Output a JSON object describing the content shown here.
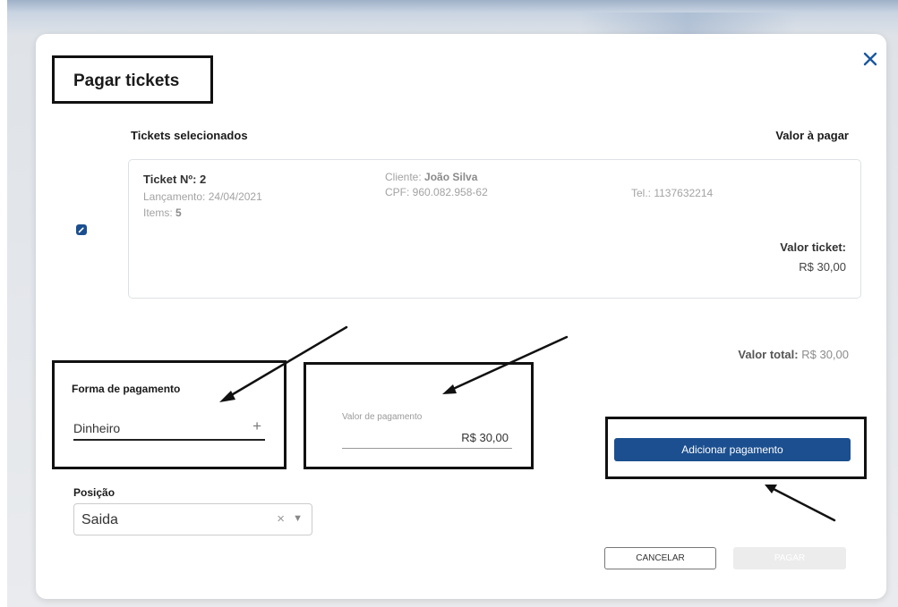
{
  "modal": {
    "title": "Pagar tickets",
    "close_icon": "close-icon"
  },
  "tickets": {
    "header_selected": "Tickets selecionados",
    "header_value": "Valor à pagar",
    "items": [
      {
        "number_label": "Ticket Nº: 2",
        "launch_label": "Lançamento: 24/04/2021",
        "items_label": "Items:",
        "items_count": "5",
        "client_label": "Cliente:",
        "client_name": "João Silva",
        "cpf_label": "CPF: 960.082.958-62",
        "phone_label": "Tel.: 1137632214",
        "value_label": "Valor ticket:",
        "value": "R$ 30,00"
      }
    ]
  },
  "total": {
    "label": "Valor total:",
    "value": "R$ 30,00"
  },
  "payment_form": {
    "label": "Forma de pagamento",
    "value": "Dinheiro",
    "expand_symbol": "+"
  },
  "payment_value": {
    "label": "Valor de pagamento",
    "value": "R$ 30,00"
  },
  "add_payment": {
    "label": "Adicionar pagamento"
  },
  "position": {
    "label": "Posição",
    "value": "Saida",
    "clear_symbol": "×",
    "caret_symbol": "▼"
  },
  "actions": {
    "cancel_label": "CANCELAR",
    "pay_label": "PAGAR"
  },
  "colors": {
    "primary": "#1b4f8f",
    "close_icon": "#1b57a1",
    "disabled_button": "#ececec"
  }
}
